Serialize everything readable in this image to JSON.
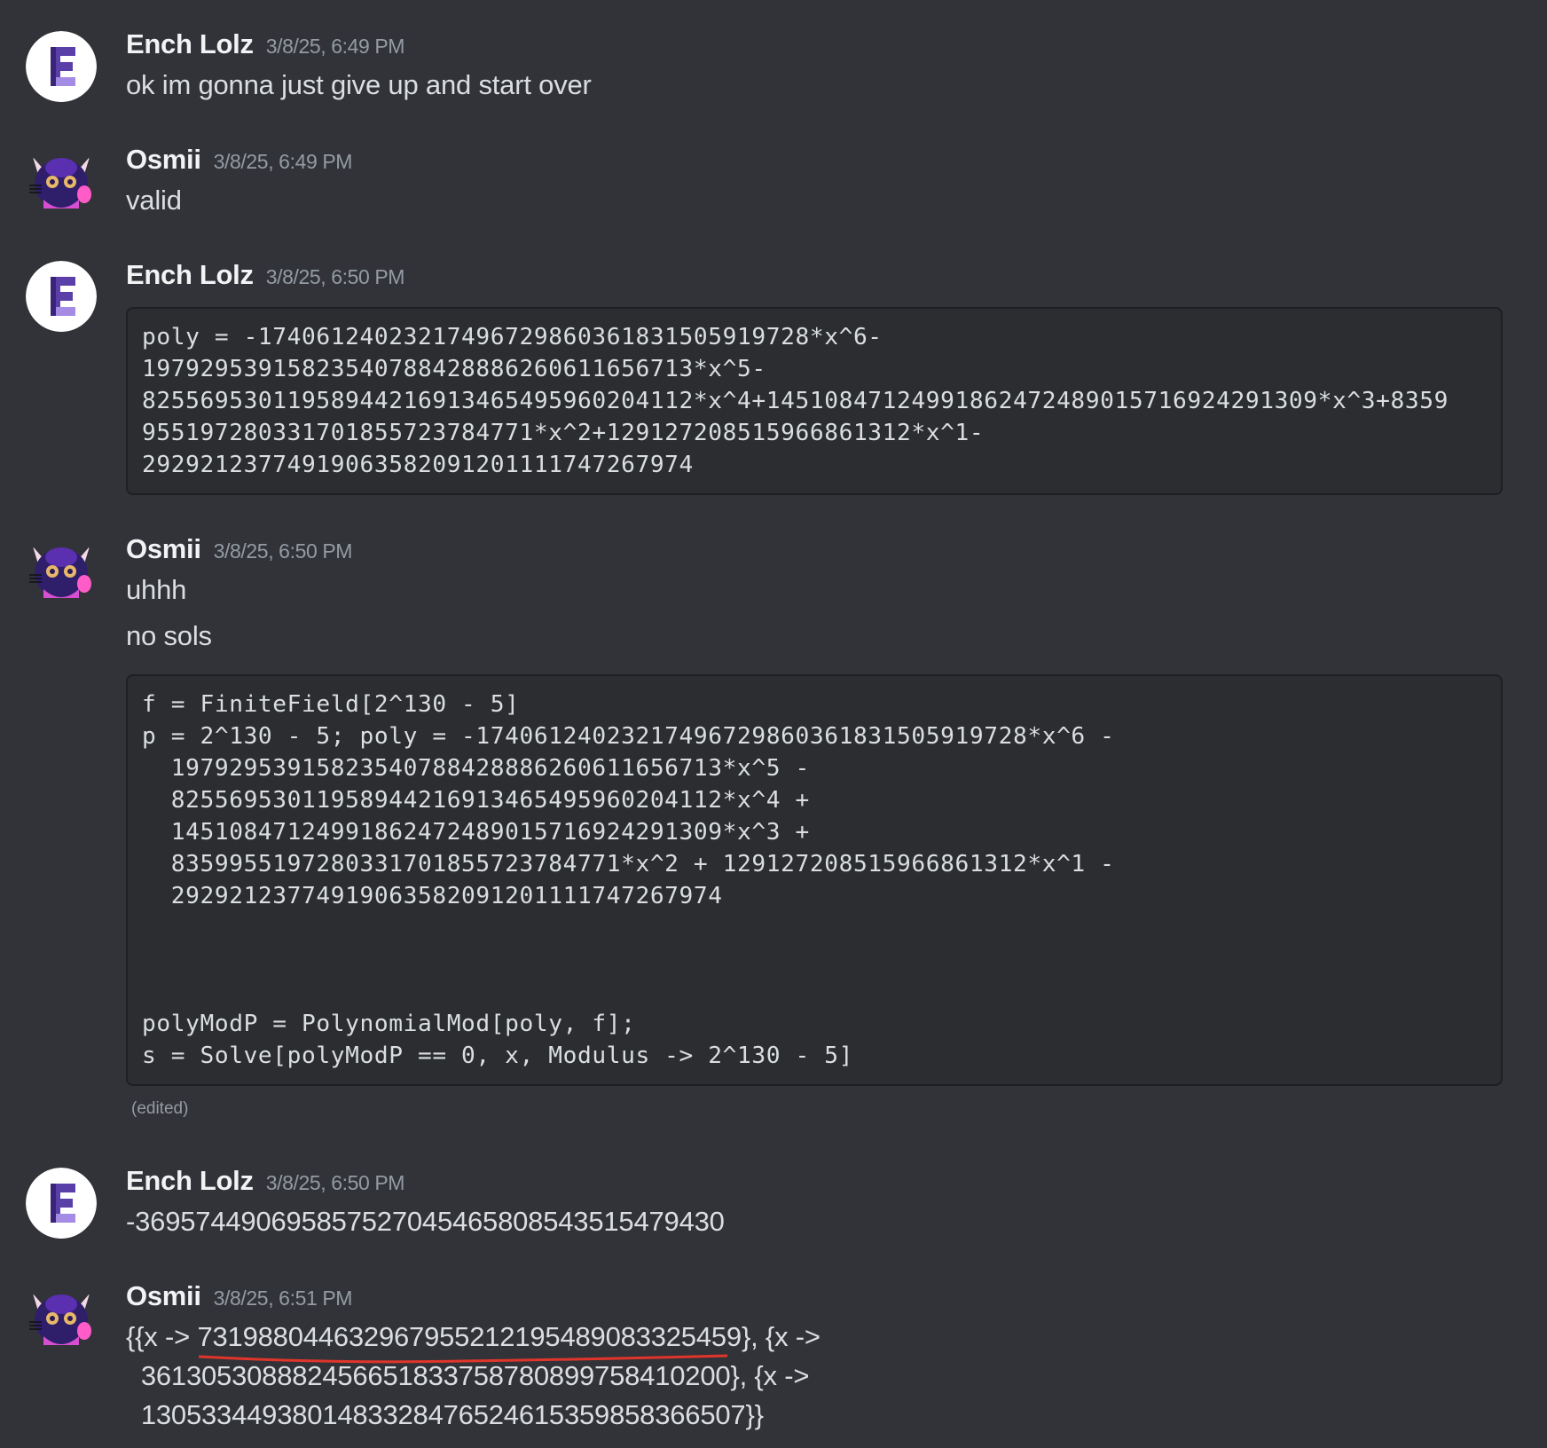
{
  "colors": {
    "background": "#323338",
    "code_background": "#2b2d31",
    "author": "#f2f3f5",
    "timestamp": "#949ba4",
    "text": "#dbdee1",
    "underline_annotation": "#e0352b"
  },
  "icons": {
    "ench_avatar": "letter-e-avatar-icon",
    "osmii_avatar": "purple-cat-avatar-icon"
  },
  "messages": [
    {
      "author": "Ench Lolz",
      "timestamp": "3/8/25, 6:49 PM",
      "text": "ok im gonna just give up and start over"
    },
    {
      "author": "Osmii",
      "timestamp": "3/8/25, 6:49 PM",
      "text": "valid"
    },
    {
      "author": "Ench Lolz",
      "timestamp": "3/8/25, 6:50 PM",
      "code": "poly = -174061240232174967298603618315059197 28*x^6-\n197929539158235407884288862606116567 13*x^5-\n82556953011958944216913465495960204112*x^4+145108471249918624724890157169242913 09*x^3+8359\n95519728033170185572378477 1*x^2+1291272085159668613 12*x^1-\n2929212377491906358209120111174726797 4"
    },
    {
      "author": "Osmii",
      "timestamp": "3/8/25, 6:50 PM",
      "lines": [
        "uhhh",
        "no sols"
      ],
      "code": "f = FiniteField[2^130 - 5]\np = 2^130 - 5; poly = -17406124023217496729860361831505919728*x^6 -\n  19792953915823540788428886260611656713*x^5 -\n  82556953011958944216913465495960204112*x^4 +\n  14510847124991862472489015716924291309*x^3 +\n  8359955197280331701855723784771*x^2 + 12912720851596686131 2*x^1 -\n  29292123774919063582091201111747267974\n\n\n\npolyModP = PolynomialMod[poly, f];\ns = Solve[polyModP == 0, x, Modulus -> 2^130 - 5]",
      "edited": "(edited)"
    },
    {
      "author": "Ench Lolz",
      "timestamp": "3/8/25, 6:50 PM",
      "text": "-36957449069585752704546580854351547943 0"
    },
    {
      "author": "Osmii",
      "timestamp": "3/8/25, 6:51 PM",
      "result": {
        "prefix": "{{x -> ",
        "highlighted_value": "73198804463296795521219548908332545 9",
        "line1_suffix": "}, {x ->",
        "line2": "  36130530888245665183375878089975841020 0}, {x ->",
        "line3": "  13053344938014833284765246153598583665 07}}"
      }
    }
  ]
}
